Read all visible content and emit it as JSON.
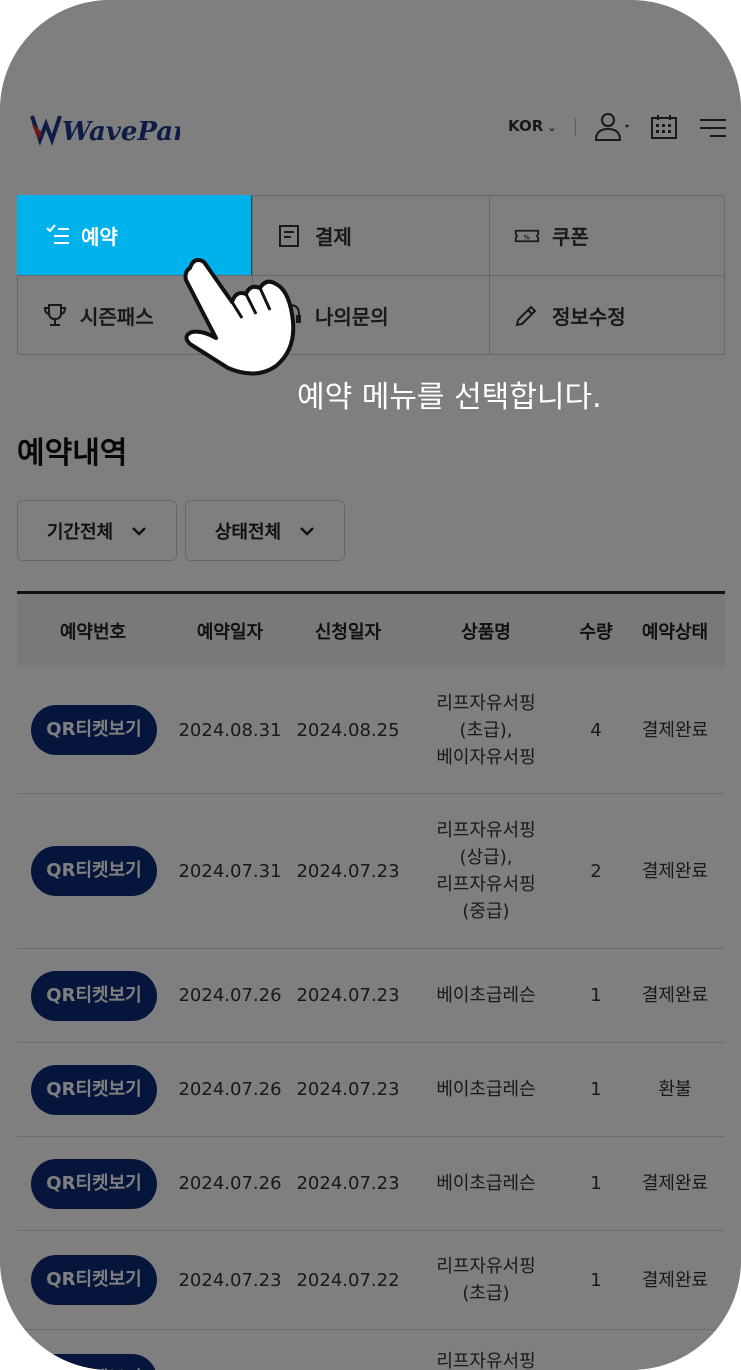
{
  "header": {
    "logo_text": "WavePark",
    "language": "KOR"
  },
  "menu": [
    {
      "label": "예약",
      "icon": "checklist-icon",
      "active": true
    },
    {
      "label": "결제",
      "icon": "receipt-icon"
    },
    {
      "label": "쿠폰",
      "icon": "coupon-icon"
    },
    {
      "label": "시즌패스",
      "icon": "trophy-icon"
    },
    {
      "label": "나의문의",
      "icon": "headset-icon"
    },
    {
      "label": "정보수정",
      "icon": "pencil-icon"
    }
  ],
  "instruction": "예약 메뉴를 선택합니다.",
  "page_title": "예약내역",
  "filters": {
    "period": "기간전체",
    "status": "상태전체"
  },
  "table": {
    "headers": [
      "예약번호",
      "예약일자",
      "신청일자",
      "상품명",
      "수량",
      "예약상태"
    ],
    "qr_button_label": "QR티켓보기",
    "rows": [
      {
        "reserve_date": "2024.08.31",
        "apply_date": "2024.08.25",
        "product": [
          "리프자유서핑",
          "(초급),",
          "베이자유서핑"
        ],
        "qty": "4",
        "status": "결제완료"
      },
      {
        "reserve_date": "2024.07.31",
        "apply_date": "2024.07.23",
        "product": [
          "리프자유서핑",
          "(상급),",
          "리프자유서핑",
          "(중급)"
        ],
        "qty": "2",
        "status": "결제완료"
      },
      {
        "reserve_date": "2024.07.26",
        "apply_date": "2024.07.23",
        "product": [
          "베이초급레슨"
        ],
        "qty": "1",
        "status": "결제완료"
      },
      {
        "reserve_date": "2024.07.26",
        "apply_date": "2024.07.23",
        "product": [
          "베이초급레슨"
        ],
        "qty": "1",
        "status": "환불"
      },
      {
        "reserve_date": "2024.07.26",
        "apply_date": "2024.07.23",
        "product": [
          "베이초급레슨"
        ],
        "qty": "1",
        "status": "결제완료"
      },
      {
        "reserve_date": "2024.07.23",
        "apply_date": "2024.07.22",
        "product": [
          "리프자유서핑",
          "(초급)"
        ],
        "qty": "1",
        "status": "결제완료"
      },
      {
        "product": [
          "리프자유서핑"
        ]
      }
    ]
  }
}
